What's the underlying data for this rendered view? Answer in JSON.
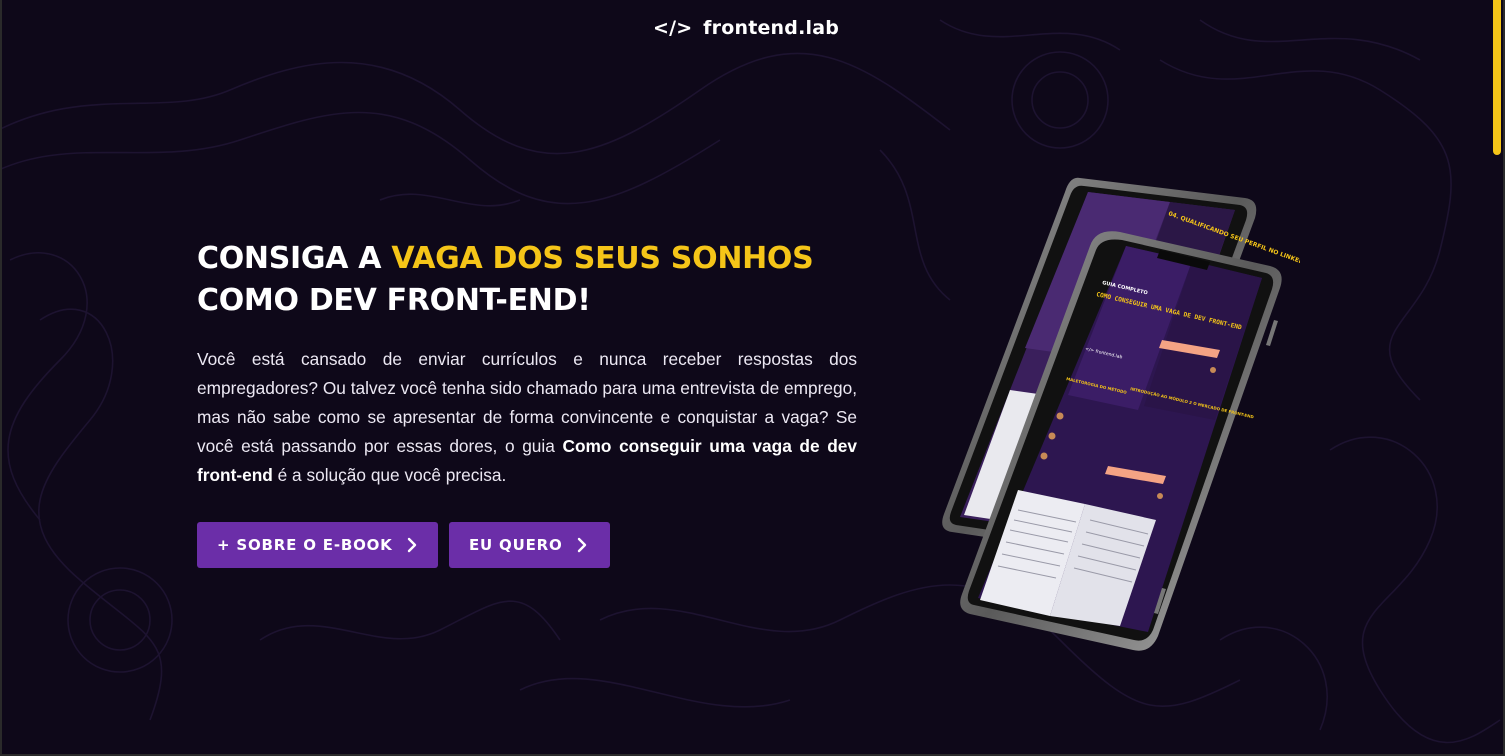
{
  "header": {
    "logo_icon": "</>",
    "brand_name": "frontend.lab"
  },
  "hero": {
    "headline_part1": "CONSIGA A ",
    "headline_highlight": "VAGA DOS SEUS SONHOS",
    "headline_part2": "COMO DEV FRONT-END!",
    "description_part1": "Você está cansado de enviar currículos e nunca receber respostas dos empregadores? Ou talvez você tenha sido chamado para uma entrevista de emprego, mas não sabe como se apresentar de forma convincente e conquistar a vaga? Se você está passando por essas dores, o guia ",
    "description_bold": "Como conseguir uma vaga de dev front-end",
    "description_part2": " é a solução que você precisa."
  },
  "buttons": {
    "about_label": "+ SOBRE O E-BOOK",
    "want_label": "EU QUERO"
  },
  "mockup": {
    "back_phone_title": "04. QUALIFICANDO SEU PERFIL NO LINKEDIN",
    "front_phone_kicker": "GUIA COMPLETO",
    "front_phone_title": "COMO CONSEGUIR UMA VAGA DE DEV FRONT-END",
    "front_phone_logo": "</> frontend.lab",
    "section_label": "MALETOROGIA DO MÉTODO",
    "section_label_2": "INTRODUÇÃO AO MÓDULO 2 O MERCADO DE FRONT-END"
  },
  "colors": {
    "background": "#0e0819",
    "accent_yellow": "#f5c518",
    "button_purple": "#6b2ea8",
    "text": "#ffffff"
  },
  "icons": [
    "chevron-right-icon",
    "code-icon"
  ]
}
